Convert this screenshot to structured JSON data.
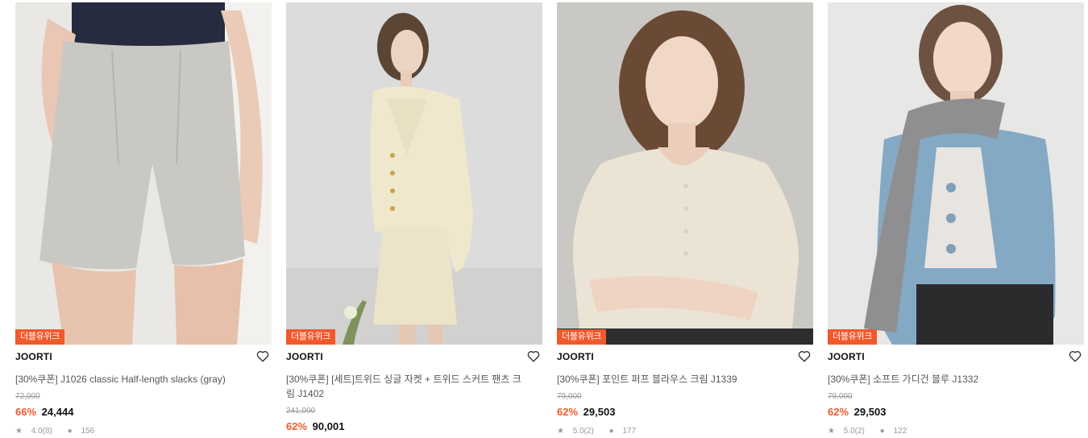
{
  "products": [
    {
      "badge": "더블유위크",
      "brand": "JOORTI",
      "title": "[30%쿠폰] J1026 classic Half-length slacks (gray)",
      "original_price": "72,000",
      "discount": "66%",
      "price": "24,444",
      "rating": "4.0(8)",
      "likes": "156"
    },
    {
      "badge": "더블유위크",
      "brand": "JOORTI",
      "title": "[30%쿠폰] [세트]트위드 싱글 자켓 + 트위드 스커트 팬츠 크림 J1402",
      "original_price": "241,000",
      "discount": "62%",
      "price": "90,001",
      "rating": "",
      "likes": ""
    },
    {
      "badge": "더블유위크",
      "brand": "JOORTI",
      "title": "[30%쿠폰] 포인트 퍼프 블라우스 크림 J1339",
      "original_price": "79,000",
      "discount": "62%",
      "price": "29,503",
      "rating": "5.0(2)",
      "likes": "177"
    },
    {
      "badge": "더블유위크",
      "brand": "JOORTI",
      "title": "[30%쿠폰] 소프트 가디건 블루 J1332",
      "original_price": "79,000",
      "discount": "62%",
      "price": "29,503",
      "rating": "5.0(2)",
      "likes": "122"
    }
  ],
  "colors": {
    "accent": "#f1592a",
    "brand_text": "#111111",
    "muted": "#999999"
  },
  "icons": {
    "wishlist": "heart-icon",
    "rating": "star-icon",
    "likes": "chat-bubble-icon"
  }
}
